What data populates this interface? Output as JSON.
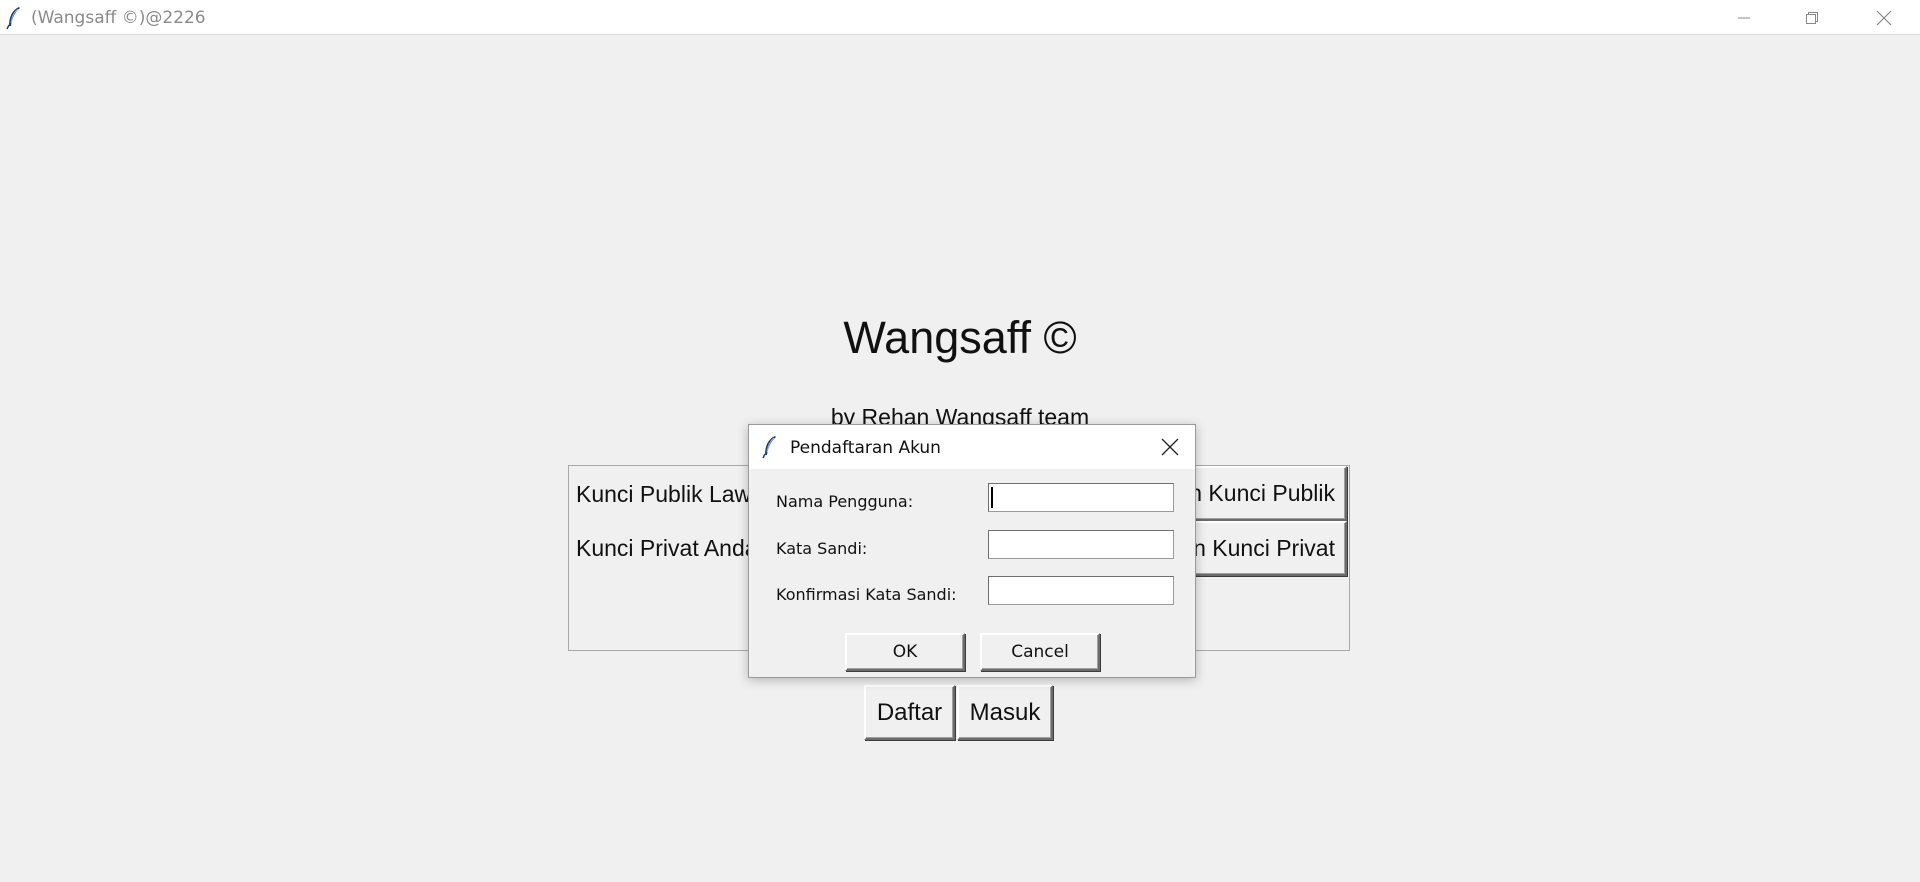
{
  "window": {
    "title": "(Wangsaff ©)@2226",
    "icon": "feather-icon",
    "controls": [
      "minimize-icon",
      "restore-icon",
      "close-icon"
    ]
  },
  "app": {
    "title": "Wangsaff ©",
    "subtitle": "by Rehan Wangsaff team",
    "public_key_label": "Kunci Publik Lawan",
    "private_key_label": "Kunci Privat Anda",
    "save_public_label": "n Kunci Publik",
    "save_private_label": "n Kunci Privat",
    "register_label": "Daftar",
    "login_label": "Masuk"
  },
  "dialog": {
    "title": "Pendaftaran Akun",
    "username_label": "Nama Pengguna:",
    "username_value": "",
    "password_label": "Kata Sandi:",
    "password_value": "",
    "confirm_label": "Konfirmasi Kata Sandi:",
    "confirm_value": "",
    "ok_label": "OK",
    "cancel_label": "Cancel"
  }
}
